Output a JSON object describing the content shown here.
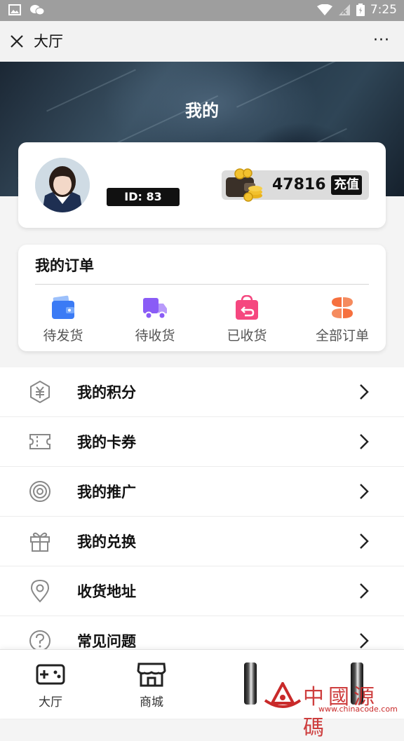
{
  "status_bar": {
    "time": "7:25"
  },
  "title_bar": {
    "title": "大厅",
    "more": "···"
  },
  "banner": {
    "title": "我的"
  },
  "profile": {
    "id_text": "ID: 83",
    "balance": "47816",
    "recharge_label": "充值"
  },
  "orders": {
    "heading": "我的订单",
    "items": [
      {
        "label": "待发货",
        "icon": "wallet-icon",
        "color": "#3b7bf5"
      },
      {
        "label": "待收货",
        "icon": "truck-icon",
        "color": "#8a5cf6"
      },
      {
        "label": "已收货",
        "icon": "return-bag-icon",
        "color": "#f5477f"
      },
      {
        "label": "全部订单",
        "icon": "grid-icon",
        "color": "#f6703e"
      }
    ]
  },
  "menu": [
    {
      "label": "我的积分",
      "icon": "points-icon"
    },
    {
      "label": "我的卡券",
      "icon": "coupon-icon"
    },
    {
      "label": "我的推广",
      "icon": "target-icon"
    },
    {
      "label": "我的兑换",
      "icon": "gift-icon"
    },
    {
      "label": "收货地址",
      "icon": "location-icon"
    },
    {
      "label": "常见问题",
      "icon": "help-icon"
    }
  ],
  "tab_bar": [
    {
      "label": "大厅",
      "icon": "gamepad-icon"
    },
    {
      "label": "商城",
      "icon": "shop-icon"
    }
  ],
  "watermark": {
    "text": "中國源碼",
    "url": "www.chinacode.com"
  }
}
